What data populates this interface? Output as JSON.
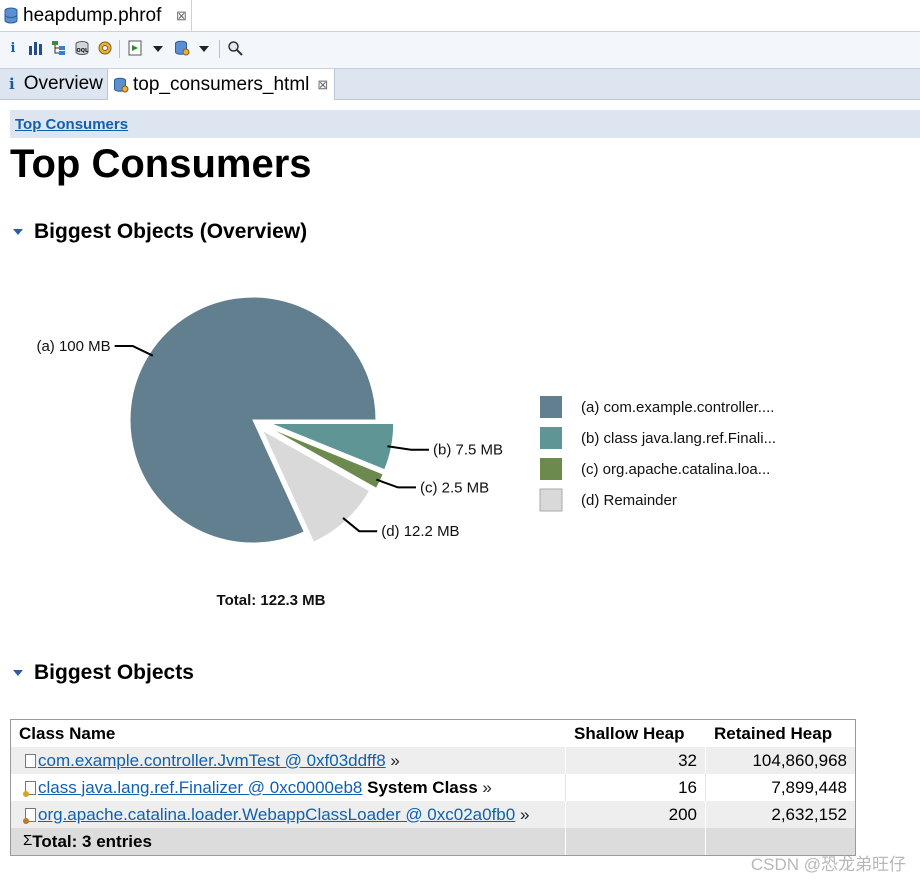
{
  "editor_tab": {
    "title": "heapdump.phrof"
  },
  "toolbar": {
    "icons": [
      "info-icon",
      "histogram-icon",
      "dominator-tree-icon",
      "oql-icon",
      "thread-overview-icon",
      "run-report-icon",
      "query-browser-icon",
      "search-icon"
    ]
  },
  "subtabs": [
    {
      "label": "Overview",
      "active": false
    },
    {
      "label": "top_consumers_html",
      "active": true
    }
  ],
  "breadcrumb": "Top Consumers",
  "page_title": "Top Consumers",
  "section_overview": {
    "title": "Biggest Objects (Overview)"
  },
  "chart_data": {
    "type": "pie",
    "slices": [
      {
        "key": "(a)",
        "value_label": "100 MB",
        "value": 100.0,
        "legend": "com.example.controller....",
        "color": "#627f8f"
      },
      {
        "key": "(b)",
        "value_label": "7.5 MB",
        "value": 7.5,
        "legend": "class java.lang.ref.Finali...",
        "color": "#5f9594"
      },
      {
        "key": "(c)",
        "value_label": "2.5 MB",
        "value": 2.5,
        "legend": "org.apache.catalina.loa...",
        "color": "#6d8a4e"
      },
      {
        "key": "(d)",
        "value_label": "12.2 MB",
        "value": 12.2,
        "legend": "Remainder",
        "color": "#d9d9d9"
      }
    ],
    "total": "Total: 122.3 MB"
  },
  "section_table": {
    "title": "Biggest Objects"
  },
  "table": {
    "columns": [
      "Class Name",
      "Shallow Heap",
      "Retained Heap"
    ],
    "rows": [
      {
        "name": "com.example.controller.JvmTest @ 0xf03ddff8",
        "suffix": "",
        "shallow": "32",
        "retained": "104,860,968"
      },
      {
        "name": "class java.lang.ref.Finalizer @ 0xc0000eb8",
        "suffix": "System Class",
        "shallow": "16",
        "retained": "7,899,448"
      },
      {
        "name": "org.apache.catalina.loader.WebappClassLoader @ 0xc02a0fb0",
        "suffix": "",
        "shallow": "200",
        "retained": "2,632,152"
      }
    ],
    "more_marker": "»",
    "total": "Total: 3 entries",
    "total_symbol": "Σ"
  },
  "watermark": "CSDN @恐龙弟旺仔"
}
